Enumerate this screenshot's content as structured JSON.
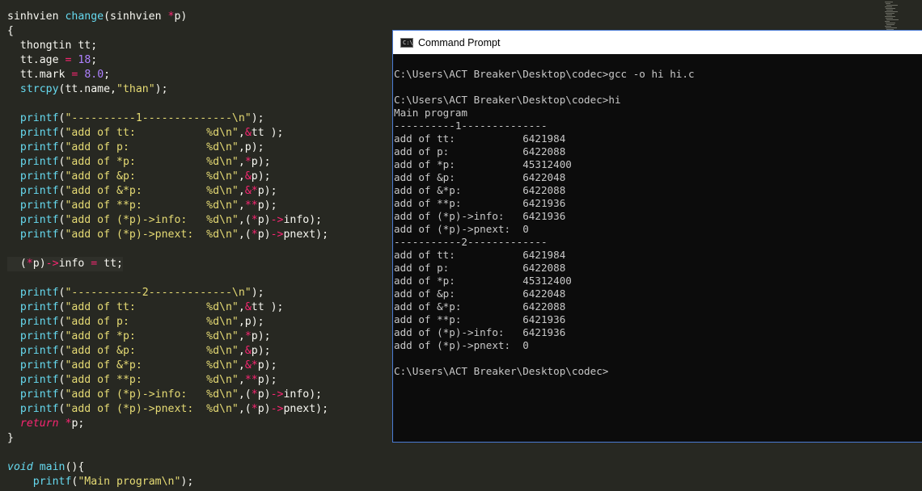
{
  "editor": {
    "lines": [
      [
        {
          "t": "sinhvien ",
          "c": "ident"
        },
        {
          "t": "change",
          "c": "fn"
        },
        {
          "t": "(sinhvien ",
          "c": "ident"
        },
        {
          "t": "*",
          "c": "op"
        },
        {
          "t": "p)",
          "c": "ident"
        }
      ],
      [
        {
          "t": "{",
          "c": "ident"
        }
      ],
      [
        {
          "t": "  thongtin tt;",
          "c": "ident"
        }
      ],
      [
        {
          "t": "  tt.age ",
          "c": "ident"
        },
        {
          "t": "=",
          "c": "op"
        },
        {
          "t": " ",
          "c": "ident"
        },
        {
          "t": "18",
          "c": "num"
        },
        {
          "t": ";",
          "c": "ident"
        }
      ],
      [
        {
          "t": "  tt.mark ",
          "c": "ident"
        },
        {
          "t": "=",
          "c": "op"
        },
        {
          "t": " ",
          "c": "ident"
        },
        {
          "t": "8.0",
          "c": "num"
        },
        {
          "t": ";",
          "c": "ident"
        }
      ],
      [
        {
          "t": "  ",
          "c": "ident"
        },
        {
          "t": "strcpy",
          "c": "fn"
        },
        {
          "t": "(tt.name,",
          "c": "ident"
        },
        {
          "t": "\"than\"",
          "c": "str"
        },
        {
          "t": ");",
          "c": "ident"
        }
      ],
      [
        {
          "t": "",
          "c": "ident"
        }
      ],
      [
        {
          "t": "  ",
          "c": "ident"
        },
        {
          "t": "printf",
          "c": "fn"
        },
        {
          "t": "(",
          "c": "ident"
        },
        {
          "t": "\"----------1--------------\\n\"",
          "c": "str"
        },
        {
          "t": ");",
          "c": "ident"
        }
      ],
      [
        {
          "t": "  ",
          "c": "ident"
        },
        {
          "t": "printf",
          "c": "fn"
        },
        {
          "t": "(",
          "c": "ident"
        },
        {
          "t": "\"add of tt:           %d\\n\"",
          "c": "str"
        },
        {
          "t": ",",
          "c": "ident"
        },
        {
          "t": "&",
          "c": "op"
        },
        {
          "t": "tt );",
          "c": "ident"
        }
      ],
      [
        {
          "t": "  ",
          "c": "ident"
        },
        {
          "t": "printf",
          "c": "fn"
        },
        {
          "t": "(",
          "c": "ident"
        },
        {
          "t": "\"add of p:            %d\\n\"",
          "c": "str"
        },
        {
          "t": ",p);",
          "c": "ident"
        }
      ],
      [
        {
          "t": "  ",
          "c": "ident"
        },
        {
          "t": "printf",
          "c": "fn"
        },
        {
          "t": "(",
          "c": "ident"
        },
        {
          "t": "\"add of *p:           %d\\n\"",
          "c": "str"
        },
        {
          "t": ",",
          "c": "ident"
        },
        {
          "t": "*",
          "c": "op"
        },
        {
          "t": "p);",
          "c": "ident"
        }
      ],
      [
        {
          "t": "  ",
          "c": "ident"
        },
        {
          "t": "printf",
          "c": "fn"
        },
        {
          "t": "(",
          "c": "ident"
        },
        {
          "t": "\"add of &p:           %d\\n\"",
          "c": "str"
        },
        {
          "t": ",",
          "c": "ident"
        },
        {
          "t": "&",
          "c": "op"
        },
        {
          "t": "p);",
          "c": "ident"
        }
      ],
      [
        {
          "t": "  ",
          "c": "ident"
        },
        {
          "t": "printf",
          "c": "fn"
        },
        {
          "t": "(",
          "c": "ident"
        },
        {
          "t": "\"add of &*p:          %d\\n\"",
          "c": "str"
        },
        {
          "t": ",",
          "c": "ident"
        },
        {
          "t": "&*",
          "c": "op"
        },
        {
          "t": "p);",
          "c": "ident"
        }
      ],
      [
        {
          "t": "  ",
          "c": "ident"
        },
        {
          "t": "printf",
          "c": "fn"
        },
        {
          "t": "(",
          "c": "ident"
        },
        {
          "t": "\"add of **p:          %d\\n\"",
          "c": "str"
        },
        {
          "t": ",",
          "c": "ident"
        },
        {
          "t": "**",
          "c": "op"
        },
        {
          "t": "p);",
          "c": "ident"
        }
      ],
      [
        {
          "t": "  ",
          "c": "ident"
        },
        {
          "t": "printf",
          "c": "fn"
        },
        {
          "t": "(",
          "c": "ident"
        },
        {
          "t": "\"add of (*p)->info:   %d\\n\"",
          "c": "str"
        },
        {
          "t": ",(",
          "c": "ident"
        },
        {
          "t": "*",
          "c": "op"
        },
        {
          "t": "p)",
          "c": "ident"
        },
        {
          "t": "->",
          "c": "op"
        },
        {
          "t": "info);",
          "c": "ident"
        }
      ],
      [
        {
          "t": "  ",
          "c": "ident"
        },
        {
          "t": "printf",
          "c": "fn"
        },
        {
          "t": "(",
          "c": "ident"
        },
        {
          "t": "\"add of (*p)->pnext:  %d\\n\"",
          "c": "str"
        },
        {
          "t": ",(",
          "c": "ident"
        },
        {
          "t": "*",
          "c": "op"
        },
        {
          "t": "p)",
          "c": "ident"
        },
        {
          "t": "->",
          "c": "op"
        },
        {
          "t": "pnext);",
          "c": "ident"
        }
      ],
      [
        {
          "t": "",
          "c": "ident"
        }
      ],
      [
        {
          "t": "  (",
          "c": "ident"
        },
        {
          "t": "*",
          "c": "op"
        },
        {
          "t": "p)",
          "c": "ident"
        },
        {
          "t": "->",
          "c": "op"
        },
        {
          "t": "info ",
          "c": "ident"
        },
        {
          "t": "=",
          "c": "op"
        },
        {
          "t": " tt;",
          "c": "ident"
        }
      ],
      [
        {
          "t": "",
          "c": "ident"
        }
      ],
      [
        {
          "t": "  ",
          "c": "ident"
        },
        {
          "t": "printf",
          "c": "fn"
        },
        {
          "t": "(",
          "c": "ident"
        },
        {
          "t": "\"-----------2-------------\\n\"",
          "c": "str"
        },
        {
          "t": ");",
          "c": "ident"
        }
      ],
      [
        {
          "t": "  ",
          "c": "ident"
        },
        {
          "t": "printf",
          "c": "fn"
        },
        {
          "t": "(",
          "c": "ident"
        },
        {
          "t": "\"add of tt:           %d\\n\"",
          "c": "str"
        },
        {
          "t": ",",
          "c": "ident"
        },
        {
          "t": "&",
          "c": "op"
        },
        {
          "t": "tt );",
          "c": "ident"
        }
      ],
      [
        {
          "t": "  ",
          "c": "ident"
        },
        {
          "t": "printf",
          "c": "fn"
        },
        {
          "t": "(",
          "c": "ident"
        },
        {
          "t": "\"add of p:            %d\\n\"",
          "c": "str"
        },
        {
          "t": ",p);",
          "c": "ident"
        }
      ],
      [
        {
          "t": "  ",
          "c": "ident"
        },
        {
          "t": "printf",
          "c": "fn"
        },
        {
          "t": "(",
          "c": "ident"
        },
        {
          "t": "\"add of *p:           %d\\n\"",
          "c": "str"
        },
        {
          "t": ",",
          "c": "ident"
        },
        {
          "t": "*",
          "c": "op"
        },
        {
          "t": "p);",
          "c": "ident"
        }
      ],
      [
        {
          "t": "  ",
          "c": "ident"
        },
        {
          "t": "printf",
          "c": "fn"
        },
        {
          "t": "(",
          "c": "ident"
        },
        {
          "t": "\"add of &p:           %d\\n\"",
          "c": "str"
        },
        {
          "t": ",",
          "c": "ident"
        },
        {
          "t": "&",
          "c": "op"
        },
        {
          "t": "p);",
          "c": "ident"
        }
      ],
      [
        {
          "t": "  ",
          "c": "ident"
        },
        {
          "t": "printf",
          "c": "fn"
        },
        {
          "t": "(",
          "c": "ident"
        },
        {
          "t": "\"add of &*p:          %d\\n\"",
          "c": "str"
        },
        {
          "t": ",",
          "c": "ident"
        },
        {
          "t": "&*",
          "c": "op"
        },
        {
          "t": "p);",
          "c": "ident"
        }
      ],
      [
        {
          "t": "  ",
          "c": "ident"
        },
        {
          "t": "printf",
          "c": "fn"
        },
        {
          "t": "(",
          "c": "ident"
        },
        {
          "t": "\"add of **p:          %d\\n\"",
          "c": "str"
        },
        {
          "t": ",",
          "c": "ident"
        },
        {
          "t": "**",
          "c": "op"
        },
        {
          "t": "p);",
          "c": "ident"
        }
      ],
      [
        {
          "t": "  ",
          "c": "ident"
        },
        {
          "t": "printf",
          "c": "fn"
        },
        {
          "t": "(",
          "c": "ident"
        },
        {
          "t": "\"add of (*p)->info:   %d\\n\"",
          "c": "str"
        },
        {
          "t": ",(",
          "c": "ident"
        },
        {
          "t": "*",
          "c": "op"
        },
        {
          "t": "p)",
          "c": "ident"
        },
        {
          "t": "->",
          "c": "op"
        },
        {
          "t": "info);",
          "c": "ident"
        }
      ],
      [
        {
          "t": "  ",
          "c": "ident"
        },
        {
          "t": "printf",
          "c": "fn"
        },
        {
          "t": "(",
          "c": "ident"
        },
        {
          "t": "\"add of (*p)->pnext:  %d\\n\"",
          "c": "str"
        },
        {
          "t": ",(",
          "c": "ident"
        },
        {
          "t": "*",
          "c": "op"
        },
        {
          "t": "p)",
          "c": "ident"
        },
        {
          "t": "->",
          "c": "op"
        },
        {
          "t": "pnext);",
          "c": "ident"
        }
      ],
      [
        {
          "t": "  ",
          "c": "ident"
        },
        {
          "t": "return",
          "c": "ret"
        },
        {
          "t": " ",
          "c": "ident"
        },
        {
          "t": "*",
          "c": "op"
        },
        {
          "t": "p;",
          "c": "ident"
        }
      ],
      [
        {
          "t": "}",
          "c": "ident"
        }
      ],
      [
        {
          "t": "",
          "c": "ident"
        }
      ],
      [
        {
          "t": "void",
          "c": "kw"
        },
        {
          "t": " ",
          "c": "ident"
        },
        {
          "t": "main",
          "c": "fn"
        },
        {
          "t": "(){",
          "c": "ident"
        }
      ],
      [
        {
          "t": "    ",
          "c": "ident"
        },
        {
          "t": "printf",
          "c": "fn"
        },
        {
          "t": "(",
          "c": "ident"
        },
        {
          "t": "\"Main program\\n\"",
          "c": "str"
        },
        {
          "t": ");",
          "c": "ident"
        }
      ]
    ],
    "cursor_line_index": 17
  },
  "cmd": {
    "title": "Command Prompt",
    "icon_label": "C:\\",
    "icon": "cmd-icon",
    "output_lines": [
      "C:\\Users\\ACT Breaker\\Desktop\\codec>gcc -o hi hi.c",
      "",
      "C:\\Users\\ACT Breaker\\Desktop\\codec>hi",
      "Main program",
      "----------1--------------",
      "add of tt:           6421984",
      "add of p:            6422088",
      "add of *p:           45312400",
      "add of &p:           6422048",
      "add of &*p:          6422088",
      "add of **p:          6421936",
      "add of (*p)->info:   6421936",
      "add of (*p)->pnext:  0",
      "-----------2-------------",
      "add of tt:           6421984",
      "add of p:            6422088",
      "add of *p:           45312400",
      "add of &p:           6422048",
      "add of &*p:          6422088",
      "add of **p:          6421936",
      "add of (*p)->info:   6421936",
      "add of (*p)->pnext:  0",
      "",
      "C:\\Users\\ACT Breaker\\Desktop\\codec>"
    ]
  },
  "colors": {
    "editor_bg": "#272822",
    "function": "#66d9ef",
    "string": "#e6db74",
    "number": "#ae81ff",
    "operator": "#f92672",
    "console_bg": "#0c0c0c",
    "console_text": "#c8c8c8",
    "window_border": "#4a7bd4"
  }
}
